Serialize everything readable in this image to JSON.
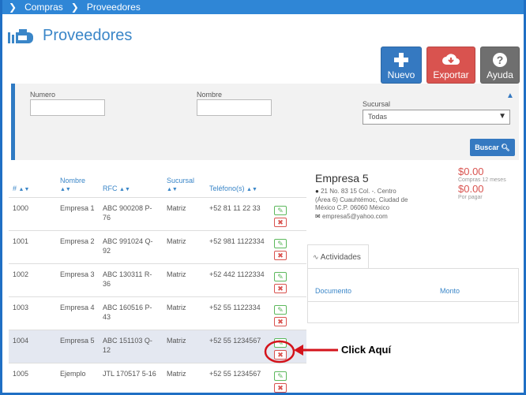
{
  "breadcrumb": {
    "items": [
      "Compras",
      "Proveedores"
    ]
  },
  "page": {
    "title": "Proveedores"
  },
  "toolbar": {
    "nuevo_label": "Nuevo",
    "exportar_label": "Exportar",
    "ayuda_label": "Ayuda",
    "nuevo_color": "#3579c1",
    "exportar_color": "#d9534f",
    "ayuda_color": "#6f6f6f"
  },
  "filters": {
    "numero_label": "Numero",
    "nombre_label": "Nombre",
    "sucursal_label": "Sucursal",
    "sucursal_value": "Todas",
    "buscar_label": "Buscar"
  },
  "table": {
    "headers": {
      "num": "#",
      "nombre": "Nombre",
      "rfc": "RFC",
      "sucursal": "Sucursal",
      "telefono": "Teléfono(s)"
    },
    "rows": [
      {
        "num": "1000",
        "nombre": "Empresa 1",
        "rfc": "ABC 900208 P-76",
        "sucursal": "Matriz",
        "telefono": "+52 81 11 22 33"
      },
      {
        "num": "1001",
        "nombre": "Empresa 2",
        "rfc": "ABC 991024 Q-92",
        "sucursal": "Matriz",
        "telefono": "+52 981 1122334"
      },
      {
        "num": "1002",
        "nombre": "Empresa 3",
        "rfc": "ABC 130311 R-36",
        "sucursal": "Matriz",
        "telefono": "+52 442 1122334"
      },
      {
        "num": "1003",
        "nombre": "Empresa 4",
        "rfc": "ABC 160516 P-43",
        "sucursal": "Matriz",
        "telefono": "+52 55 1122334"
      },
      {
        "num": "1004",
        "nombre": "Empresa 5",
        "rfc": "ABC 151103 Q-12",
        "sucursal": "Matriz",
        "telefono": "+52 55 1234567"
      },
      {
        "num": "1005",
        "nombre": "Ejemplo",
        "rfc": "JTL 170517 5-16",
        "sucursal": "Matriz",
        "telefono": "+52 55 1234567"
      }
    ]
  },
  "detail": {
    "name": "Empresa 5",
    "address": "21 No. 83 15 Col. -. Centro (Área 6) Cuauhtémoc, Ciudad de México C.P. 06060 México",
    "email": "empresa5@yahoo.com",
    "compras_amount": "$0.00",
    "compras_label": "Compras 12 meses",
    "por_pagar_amount": "$0.00",
    "por_pagar_label": "Por pagar"
  },
  "actividades": {
    "tab_label": "Actividades",
    "col_documento": "Documento",
    "col_monto": "Monto"
  },
  "annotation": {
    "label": "Click Aquí",
    "color": "#d4141c"
  }
}
